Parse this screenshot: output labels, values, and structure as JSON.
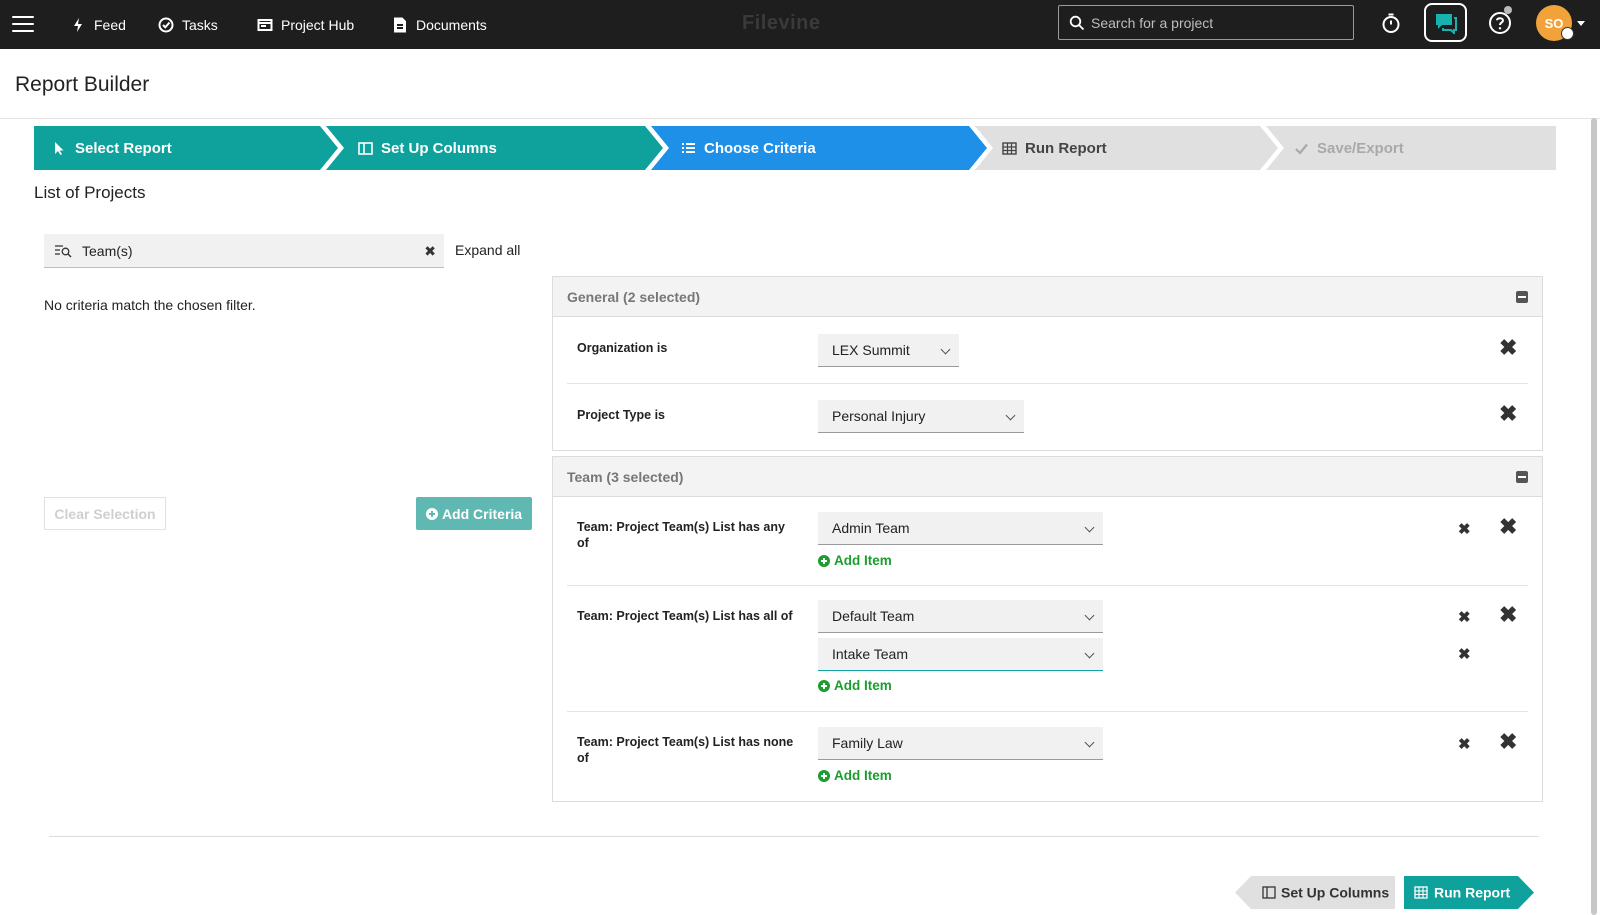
{
  "nav": {
    "feed": "Feed",
    "tasks": "Tasks",
    "project_hub": "Project Hub",
    "documents": "Documents",
    "brand": "Filevine",
    "search_placeholder": "Search for a project",
    "avatar_initials": "SO"
  },
  "page": {
    "title": "Report Builder",
    "subtitle": "List of Projects"
  },
  "steps": [
    {
      "label": "Select Report",
      "state": "done",
      "color": "#0fa19b"
    },
    {
      "label": "Set Up Columns",
      "state": "done",
      "color": "#0fa19b"
    },
    {
      "label": "Choose Criteria",
      "state": "current",
      "color": "#1e90e8"
    },
    {
      "label": "Run Report",
      "state": "pending",
      "color": "#e0e0e0"
    },
    {
      "label": "Save/Export",
      "state": "disabled",
      "color": "#e0e0e0"
    }
  ],
  "filter": {
    "value": "Team(s)",
    "expand_all": "Expand all",
    "no_match": "No criteria match the chosen filter."
  },
  "buttons": {
    "clear_selection": "Clear Selection",
    "add_criteria": "Add Criteria",
    "add_item": "Add Item",
    "prev": "Set Up Columns",
    "next": "Run Report"
  },
  "general": {
    "header": "General (2 selected)",
    "rows": [
      {
        "label": "Organization is",
        "value": "LEX Summit"
      },
      {
        "label": "Project Type is",
        "value": "Personal Injury"
      }
    ]
  },
  "team": {
    "header": "Team (3 selected)",
    "rows": [
      {
        "label": "Team: Project Team(s) List has any of",
        "values": [
          "Admin Team"
        ]
      },
      {
        "label": "Team: Project Team(s) List has all of",
        "values": [
          "Default Team",
          "Intake Team"
        ]
      },
      {
        "label": "Team: Project Team(s) List has none of",
        "values": [
          "Family Law"
        ]
      }
    ]
  }
}
